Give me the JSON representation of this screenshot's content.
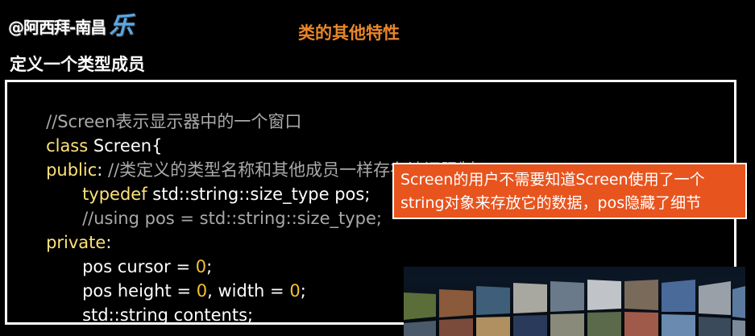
{
  "watermark": {
    "text": "@阿西拜-南昌",
    "logo_glyph": "乐"
  },
  "slide": {
    "top_title": "类的其他特性",
    "section_title": "定义一个类型成员"
  },
  "code": {
    "line1": "//Screen表示显示器中的一个窗口",
    "line2_kw": "class",
    "line2_rest": " Screen{",
    "line3_kw": "public",
    "line3_colon": ":",
    "line3_comment": " //类定义的类型名称和其他成员一样存在访问限制",
    "line4_kw": "typedef",
    "line4_rest": " std::string::size_type pos;",
    "line5": "//using pos = std::string::size_type;",
    "line6_kw": "private",
    "line6_colon": ":",
    "line7_a": "pos cursor = ",
    "line7_num": "0",
    "line7_b": ";",
    "line8_a": "pos height = ",
    "line8_num1": "0",
    "line8_b": ", width = ",
    "line8_num2": "0",
    "line8_c": ";",
    "line9": "std::string contents;",
    "line10": "};"
  },
  "callout": {
    "line1": "Screen的用户不需要知道Screen使用了一个",
    "line2": "string对象来存放它的数据，pos隐藏了细节"
  },
  "colors": {
    "title_orange": "#e8862a",
    "keyword_yellow": "#ffe27a",
    "comment_gray": "#a9a9a9",
    "number_gold": "#f2c230",
    "callout_bg": "#e8541e"
  }
}
